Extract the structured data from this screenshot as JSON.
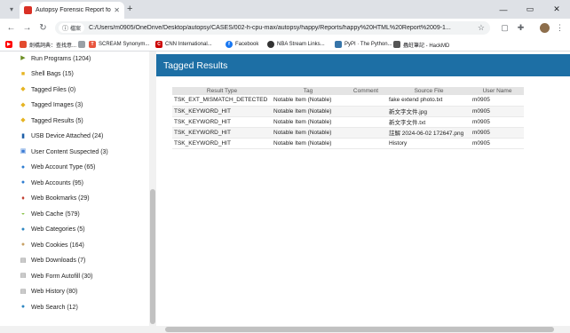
{
  "browser": {
    "tab_title": "Autopsy Forensic Report for c",
    "url": "C:/Users/m0905/OneDrive/Desktop/autopsy/CASES/002-h-cpu-max/autopsy/happy/Reports/happy%20HTML%20Report%2009-1...",
    "site_chip": "檔案",
    "bookmarks": [
      {
        "label": "",
        "color": "#ff0000"
      },
      {
        "label": "劍橋詞典：查找意...",
        "color": "#e34b2e"
      },
      {
        "label": "",
        "color": "#5f6368"
      },
      {
        "label": "SCREAM Synonym...",
        "color": "#e8553e"
      },
      {
        "label": "CNN International...",
        "color": "#cc0000"
      },
      {
        "label": "Facebook",
        "color": "#1877f2"
      },
      {
        "label": "NBA Stream Links...",
        "color": "#333333"
      },
      {
        "label": "PyPI · The Python...",
        "color": "#3775a9"
      },
      {
        "label": "蟲蛀筆記 - HackMD",
        "color": "#555555"
      }
    ]
  },
  "sidebar": {
    "items": [
      {
        "label": "Run Programs (1204)",
        "icon": "run-icon",
        "glyph": "▶",
        "color": "#6b8e23"
      },
      {
        "label": "Shell Bags (15)",
        "icon": "folder-icon",
        "glyph": "■",
        "color": "#e6b422"
      },
      {
        "label": "Tagged Files (0)",
        "icon": "tag-icon",
        "glyph": "◆",
        "color": "#e6b422"
      },
      {
        "label": "Tagged Images (3)",
        "icon": "tag-icon",
        "glyph": "◆",
        "color": "#e6b422"
      },
      {
        "label": "Tagged Results (5)",
        "icon": "tag-icon",
        "glyph": "◆",
        "color": "#e6b422"
      },
      {
        "label": "USB Device Attached (24)",
        "icon": "usb-icon",
        "glyph": "▮",
        "color": "#1e5fa8"
      },
      {
        "label": "User Content Suspected (3)",
        "icon": "image-icon",
        "glyph": "▣",
        "color": "#3a7bd5"
      },
      {
        "label": "Web Account Type (65)",
        "icon": "user-icon",
        "glyph": "●",
        "color": "#2e7dd1"
      },
      {
        "label": "Web Accounts (95)",
        "icon": "user-icon",
        "glyph": "●",
        "color": "#2e7dd1"
      },
      {
        "label": "Web Bookmarks (29)",
        "icon": "bookmark-icon",
        "glyph": "♦",
        "color": "#c0392b"
      },
      {
        "label": "Web Cache (579)",
        "icon": "cache-icon",
        "glyph": "◒",
        "color": "#8bc34a"
      },
      {
        "label": "Web Categories (5)",
        "icon": "globe-icon",
        "glyph": "●",
        "color": "#2e86c1"
      },
      {
        "label": "Web Cookies (164)",
        "icon": "cookie-icon",
        "glyph": "●",
        "color": "#c8a165"
      },
      {
        "label": "Web Downloads (7)",
        "icon": "download-icon",
        "glyph": "▤",
        "color": "#777777"
      },
      {
        "label": "Web Form Autofill (30)",
        "icon": "form-icon",
        "glyph": "▤",
        "color": "#777777"
      },
      {
        "label": "Web History (80)",
        "icon": "history-icon",
        "glyph": "▤",
        "color": "#777777"
      },
      {
        "label": "Web Search (12)",
        "icon": "globe-icon",
        "glyph": "●",
        "color": "#2e86c1"
      }
    ]
  },
  "main": {
    "title": "Tagged Results",
    "columns": [
      "Result Type",
      "Tag",
      "Comment",
      "Source File",
      "User Name"
    ],
    "rows": [
      [
        "TSK_EXT_MISMATCH_DETECTED",
        "Notable Item (Notable)",
        "",
        "fake extend photo.txt",
        "m0905"
      ],
      [
        "TSK_KEYWORD_HIT",
        "Notable Item (Notable)",
        "",
        "新文字文件.jpg",
        "m0905"
      ],
      [
        "TSK_KEYWORD_HIT",
        "Notable Item (Notable)",
        "",
        "新文字文件.txt",
        "m0905"
      ],
      [
        "TSK_KEYWORD_HIT",
        "Notable Item (Notable)",
        "",
        "註解 2024-06-02 172647.png",
        "m0905"
      ],
      [
        "TSK_KEYWORD_HIT",
        "Notable Item (Notable)",
        "",
        "History",
        "m0905"
      ]
    ]
  }
}
